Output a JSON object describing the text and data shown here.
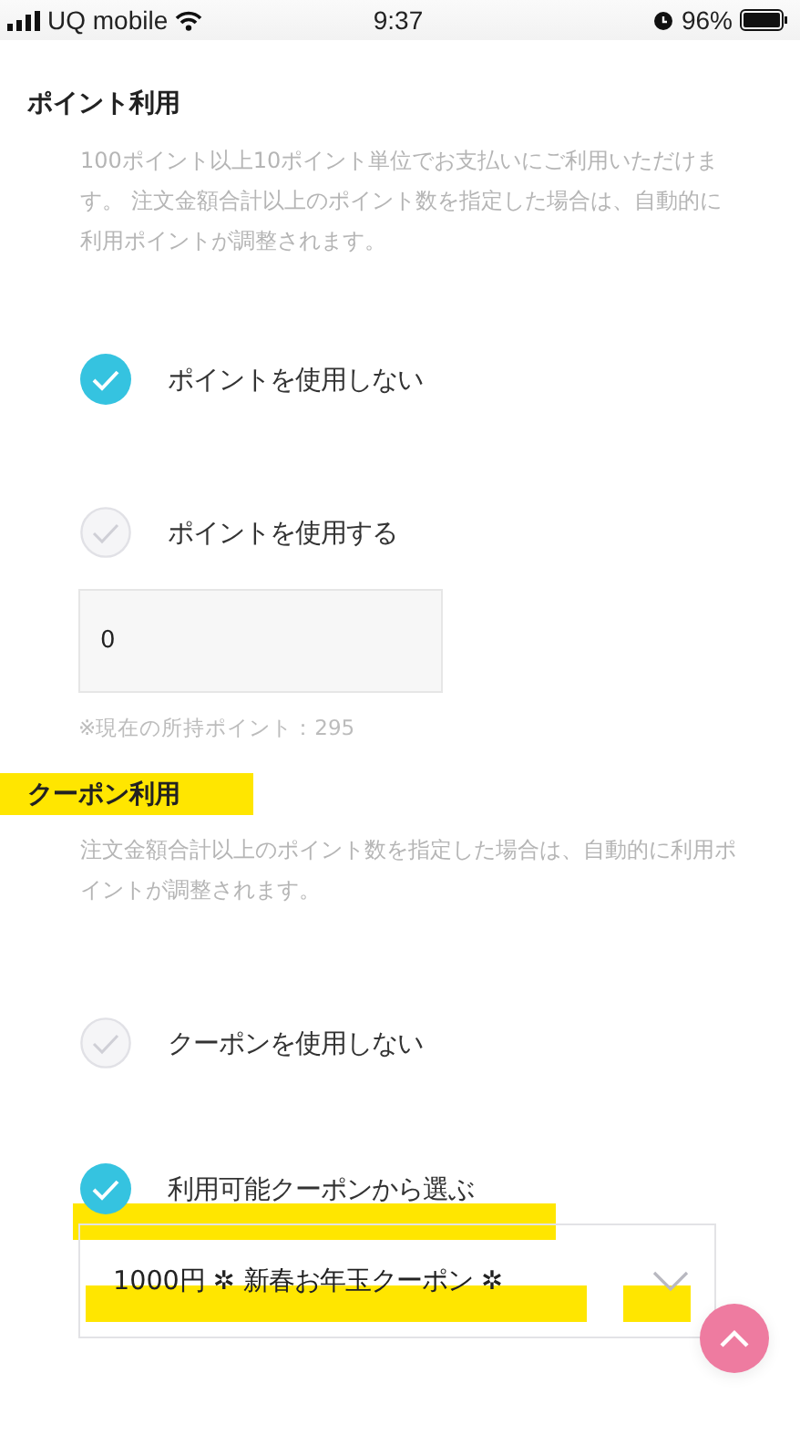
{
  "status_bar": {
    "carrier": "UQ mobile",
    "time": "9:37",
    "battery": "96%"
  },
  "points": {
    "title": "ポイント利用",
    "description": "100ポイント以上10ポイント単位でお支払いにご利用いただけます。 注文金額合計以上のポイント数を指定した場合は、自動的に利用ポイントが調整されます。",
    "options": [
      {
        "label": "ポイントを使用しない",
        "selected": true
      },
      {
        "label": "ポイントを使用する",
        "selected": false
      }
    ],
    "amount_field": {
      "value": "0"
    },
    "note": "※現在の所持ポイント：295"
  },
  "coupons": {
    "title": "クーポン利用",
    "description": "注文金額合計以上のポイント数を指定した場合は、自動的に利用ポイントが調整されます。",
    "options": [
      {
        "label": "クーポンを使用しない",
        "selected": false
      },
      {
        "label": "利用可能クーポンから選ぶ",
        "selected": true
      }
    ],
    "coupon_select": {
      "value": "1000円 ✲ 新春お年玉クーポン ✲"
    }
  }
}
